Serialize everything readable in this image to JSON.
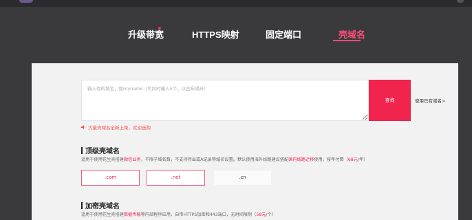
{
  "tabs": [
    {
      "label": "升级带宽"
    },
    {
      "label": "HTTPS映射"
    },
    {
      "label": "固定端口"
    },
    {
      "label": "壳域名"
    }
  ],
  "search": {
    "placeholder": "输入你的域名，如myname（可同时输入5个，以回车隔开）",
    "button_label": "查询",
    "own_domain_link": "使用已有域名>"
  },
  "notice": {
    "text": "大量壳域名全新上架，欢迎选购"
  },
  "top_level": {
    "title": "顶级壳域名",
    "desc_part1": "适用于使用花生壳搭建",
    "desc_highlight1": "微信业务",
    "desc_part2": "，不限子域名数，不支持持出或A记录等域名设置。默认使用海外线路建议搭配",
    "desc_highlight2": "国内线路迁移",
    "desc_part3": "使用，按年付费（",
    "desc_price": "68元",
    "desc_part4": "/年）",
    "extensions": [
      ".com",
      ".net",
      ".cn"
    ]
  },
  "encrypted": {
    "title": "加密壳域名",
    "desc_part1": "适用于使用花生壳搭建",
    "desc_highlight1": "数据传输",
    "desc_part2": "等内部程序应用，自带HTTPS加密和443端口，无时间限制（",
    "desc_price": "58元",
    "desc_part3": "/个）"
  },
  "colors": {
    "accent": "#f0244d",
    "active_tab": "#ff4d7a",
    "background": "#3a3a3d",
    "panel": "#f2f2f3"
  },
  "icons": {
    "notice": "speaker-icon"
  }
}
